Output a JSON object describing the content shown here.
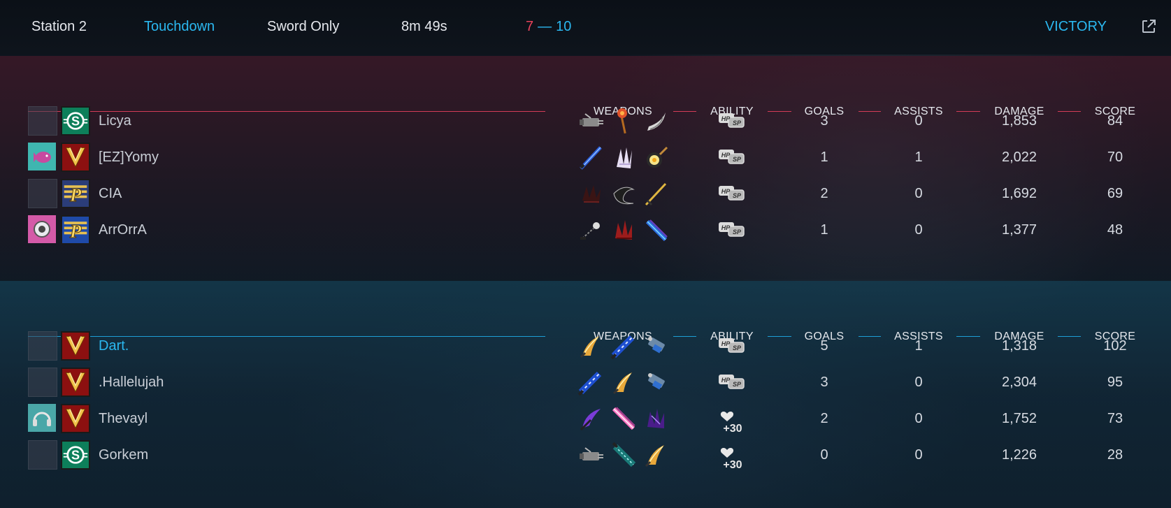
{
  "header": {
    "map": "Station 2",
    "mode": "Touchdown",
    "rule": "Sword Only",
    "duration": "8m 49s",
    "score_red": "7",
    "score_separator": "—",
    "score_blue": "10",
    "result": "VICTORY",
    "external_link_icon": "external-link-icon"
  },
  "columns": {
    "weapons": "WEAPONS",
    "ability": "ABILITY",
    "goals": "GOALS",
    "assists": "ASSISTS",
    "damage": "DAMAGE",
    "score": "SCORE"
  },
  "colors": {
    "red_team": "#d43c57",
    "blue_team": "#1d9fd6",
    "highlight": "#2bb8f0"
  },
  "teams": [
    {
      "side": "red",
      "players": [
        {
          "name": "Licya",
          "has_slot_icon": false,
          "badge": "green-s-badge",
          "weapons": [
            "gatling-gun-icon",
            "fire-hammer-icon",
            "scythe-blade-icon"
          ],
          "ability": "hp-sp-icon",
          "goals": "3",
          "assists": "0",
          "damage": "1,853",
          "score": "84"
        },
        {
          "name": "[EZ]Yomy",
          "has_slot_icon": true,
          "slot_icon": "pink-fish-icon",
          "badge": "red-gold-v-badge",
          "weapons": [
            "blue-katana-icon",
            "white-claw-icon",
            "frying-pan-icon"
          ],
          "ability": "hp-sp-icon",
          "goals": "1",
          "assists": "1",
          "damage": "2,022",
          "score": "70"
        },
        {
          "name": "CIA",
          "has_slot_icon": false,
          "badge": "gold-p-badge",
          "weapons": [
            "dark-claw-icon",
            "black-horn-icon",
            "golden-sword-icon"
          ],
          "ability": "hp-sp-icon",
          "goals": "2",
          "assists": "0",
          "damage": "1,692",
          "score": "69"
        },
        {
          "name": "ArrOrrA",
          "has_slot_icon": true,
          "slot_icon": "pink-speaker-icon",
          "badge": "blue-gold-p-badge",
          "weapons": [
            "chain-flail-icon",
            "red-claw-icon",
            "blue-blade-icon"
          ],
          "ability": "hp-sp-icon",
          "goals": "1",
          "assists": "0",
          "damage": "1,377",
          "score": "48"
        }
      ]
    },
    {
      "side": "blue",
      "players": [
        {
          "name": "Dart.",
          "is_self": true,
          "has_slot_icon": false,
          "badge": "red-gold-v-badge",
          "weapons": [
            "golden-wing-blade-icon",
            "blue-greatsword-icon",
            "blue-cannon-icon"
          ],
          "ability": "hp-sp-icon",
          "goals": "5",
          "assists": "1",
          "damage": "1,318",
          "score": "102"
        },
        {
          "name": ".Hallelujah",
          "has_slot_icon": false,
          "badge": "red-gold-v-badge",
          "weapons": [
            "blue-greatsword-icon",
            "golden-wing-blade-icon",
            "blue-cannon-icon"
          ],
          "ability": "hp-sp-icon",
          "goals": "3",
          "assists": "0",
          "damage": "2,304",
          "score": "95"
        },
        {
          "name": "Thevayl",
          "has_slot_icon": true,
          "slot_icon": "headphones-icon",
          "badge": "red-gold-v-badge",
          "weapons": [
            "purple-scythe-icon",
            "pink-energy-blade-icon",
            "purple-claw-icon"
          ],
          "ability": "heart-plus-30-icon",
          "ability_text": "+30",
          "goals": "2",
          "assists": "0",
          "damage": "1,752",
          "score": "73"
        },
        {
          "name": "Gorkem",
          "has_slot_icon": false,
          "badge": "green-s-badge",
          "weapons": [
            "gatling-gun-icon",
            "teal-greatsword-icon",
            "golden-wing-blade-icon"
          ],
          "ability": "heart-plus-30-icon",
          "ability_text": "+30",
          "goals": "0",
          "assists": "0",
          "damage": "1,226",
          "score": "28"
        }
      ]
    }
  ]
}
